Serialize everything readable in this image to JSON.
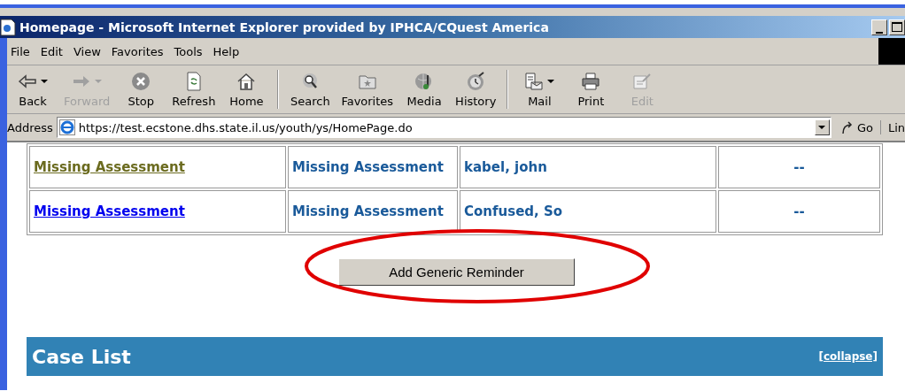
{
  "window": {
    "title": "Homepage - Microsoft Internet Explorer provided by IPHCA/CQuest America"
  },
  "menu": [
    "File",
    "Edit",
    "View",
    "Favorites",
    "Tools",
    "Help"
  ],
  "toolbar": [
    [
      {
        "label": "Back",
        "kind": "back",
        "disabled": false,
        "dropdown": true
      },
      {
        "label": "Forward",
        "kind": "forward",
        "disabled": true,
        "dropdown": true
      },
      {
        "label": "Stop",
        "kind": "stop",
        "disabled": false,
        "dropdown": false
      },
      {
        "label": "Refresh",
        "kind": "refresh",
        "disabled": false,
        "dropdown": false
      },
      {
        "label": "Home",
        "kind": "home",
        "disabled": false,
        "dropdown": false
      }
    ],
    [
      {
        "label": "Search",
        "kind": "search",
        "disabled": false,
        "dropdown": false
      },
      {
        "label": "Favorites",
        "kind": "favorites",
        "disabled": false,
        "dropdown": false
      },
      {
        "label": "Media",
        "kind": "media",
        "disabled": false,
        "dropdown": false
      },
      {
        "label": "History",
        "kind": "history",
        "disabled": false,
        "dropdown": false
      }
    ],
    [
      {
        "label": "Mail",
        "kind": "mail",
        "disabled": false,
        "dropdown": true
      },
      {
        "label": "Print",
        "kind": "print",
        "disabled": false,
        "dropdown": false
      },
      {
        "label": "Edit",
        "kind": "edit",
        "disabled": true,
        "dropdown": false
      }
    ]
  ],
  "address_bar": {
    "label": "Address",
    "value": "https://test.ecstone.dhs.state.il.us/youth/ys/HomePage.do",
    "go": "Go",
    "links": "Lin"
  },
  "reminders": {
    "rows": [
      {
        "link": "Missing Assessment",
        "visited": true,
        "type": "Missing Assessment",
        "client": "kabel, john",
        "column_4": "--"
      },
      {
        "link": "Missing Assessment",
        "visited": false,
        "type": "Missing Assessment",
        "client": "Confused, So",
        "column_4": "--"
      }
    ],
    "button": "Add Generic Reminder"
  },
  "case_list": {
    "title": "Case List",
    "collapse": "[collapse]"
  }
}
